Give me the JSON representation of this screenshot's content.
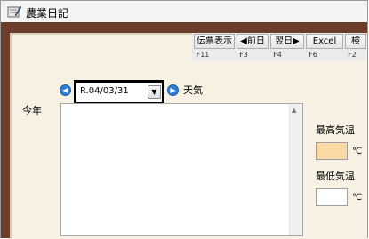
{
  "window": {
    "title": "農業日記"
  },
  "toolbar": {
    "buttons": [
      {
        "label": "伝票表示",
        "key": "F11"
      },
      {
        "label": "◀前日",
        "key": "F3"
      },
      {
        "label": "翌日▶",
        "key": "F4"
      },
      {
        "label": "Excel",
        "key": "F6"
      },
      {
        "label": "検",
        "key": "F2"
      }
    ]
  },
  "date_picker": {
    "value": "R.04/03/31"
  },
  "weather": {
    "label": "天気"
  },
  "today": {
    "label": "今年"
  },
  "temperature": {
    "max_label": "最高気温",
    "min_label": "最低気温",
    "unit": "℃",
    "max_value": "",
    "min_value": ""
  },
  "colors": {
    "accent": "#2c7bd6",
    "board": "#6b3c2a",
    "paper": "#f6f1e3",
    "highlight_input": "#fbd9a5"
  }
}
